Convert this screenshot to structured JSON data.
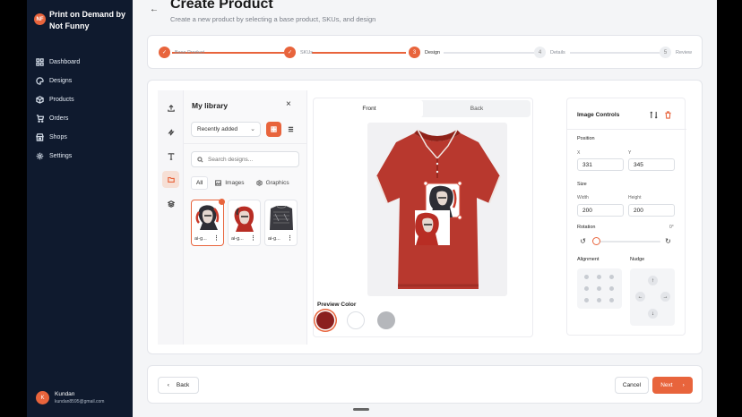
{
  "app": {
    "brand_initials": "NF",
    "brand_name": "Print on Demand by Not Funny"
  },
  "sidebar": {
    "items": [
      {
        "label": "Dashboard",
        "icon": "grid-icon"
      },
      {
        "label": "Designs",
        "icon": "palette-icon"
      },
      {
        "label": "Products",
        "icon": "box-icon"
      },
      {
        "label": "Orders",
        "icon": "cart-icon"
      },
      {
        "label": "Shops",
        "icon": "store-icon"
      },
      {
        "label": "Settings",
        "icon": "gear-icon"
      }
    ]
  },
  "user": {
    "initial": "K",
    "name": "Kundan",
    "email": "kundan8595@gmail.com"
  },
  "header": {
    "title": "Create Product",
    "subtitle": "Create a new product by selecting a base product, SKUs, and design"
  },
  "steps": [
    {
      "label": "Base Product",
      "status": "done",
      "number": "1"
    },
    {
      "label": "SKUs",
      "status": "done",
      "number": "2"
    },
    {
      "label": "Design",
      "status": "active",
      "number": "3"
    },
    {
      "label": "Details",
      "status": "todo",
      "number": "4"
    },
    {
      "label": "Review",
      "status": "todo",
      "number": "5"
    }
  ],
  "library": {
    "title": "My library",
    "close": "×",
    "sort_value": "Recently added",
    "search_placeholder": "Search designs...",
    "filters": [
      "All",
      "Images",
      "Graphics"
    ],
    "items": [
      {
        "name": "ai-g...",
        "selected": true
      },
      {
        "name": "ai-g...",
        "selected": false
      },
      {
        "name": "ai-g...",
        "selected": false
      }
    ]
  },
  "preview": {
    "tabs": [
      "Front",
      "Back"
    ],
    "active_tab": "Front",
    "color_label": "Preview Color",
    "colors": [
      "#8b1f1f",
      "#ffffff",
      "#b5b7bb"
    ],
    "selected_color": "#8b1f1f",
    "shirt_color": "#b8382e"
  },
  "controls": {
    "title": "Image Controls",
    "position_label": "Position",
    "x_label": "X",
    "x_value": "331",
    "y_label": "Y",
    "y_value": "345",
    "size_label": "Size",
    "width_label": "Width",
    "width_value": "200",
    "height_label": "Height",
    "height_value": "200",
    "rotation_label": "Rotation",
    "rotation_value": "0°",
    "rotation_level": 0,
    "alignment_label": "Alignment",
    "nudge_label": "Nudge"
  },
  "footer": {
    "back_label": "Back",
    "cancel_label": "Cancel",
    "next_label": "Next"
  },
  "colors": {
    "accent": "#e8643c",
    "sidebar_bg": "#0f1a2e"
  }
}
